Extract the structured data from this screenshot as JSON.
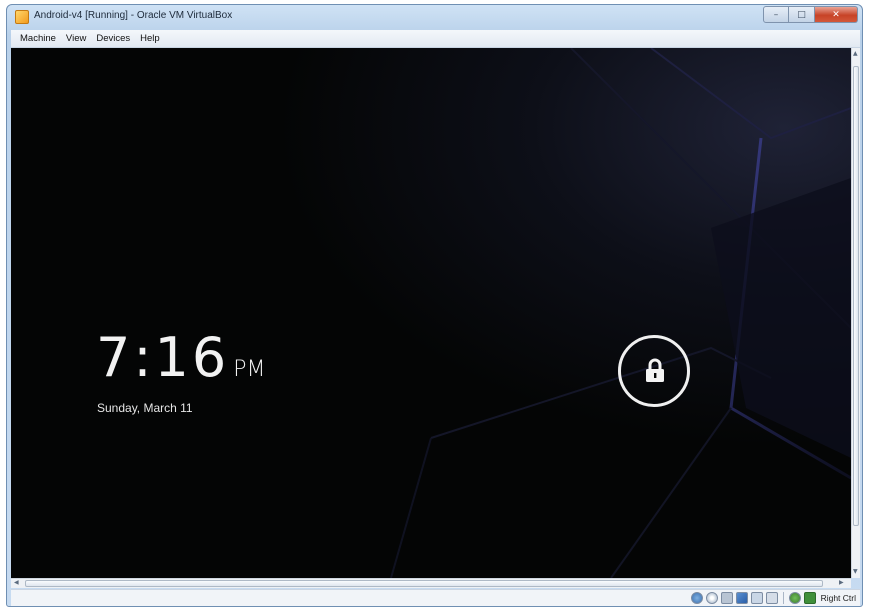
{
  "window": {
    "title": "Android-v4 [Running] - Oracle VM VirtualBox",
    "minimize_glyph": "–",
    "maximize_glyph": "□",
    "close_glyph": "✕"
  },
  "menu": {
    "items": [
      {
        "label": "Machine"
      },
      {
        "label": "View"
      },
      {
        "label": "Devices"
      },
      {
        "label": "Help"
      }
    ]
  },
  "lockscreen": {
    "time": "7:16",
    "ampm": "PM",
    "date": "Sunday, March 11",
    "unlock_icon": "lock-icon",
    "background_color": "#040505"
  },
  "statusbar": {
    "icons": [
      "hard-disk-icon",
      "optical-drive-icon",
      "usb-icon",
      "network-icon",
      "shared-folder-icon",
      "display-icon",
      "mouse-capture-icon",
      "keyboard-capture-icon"
    ],
    "host_key": "Right Ctrl"
  }
}
